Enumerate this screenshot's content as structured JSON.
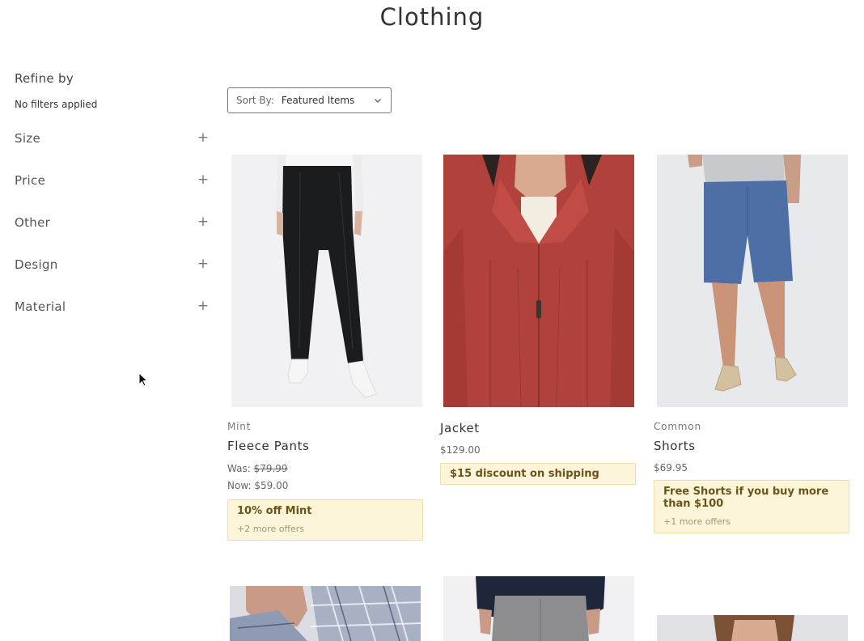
{
  "page": {
    "title": "Clothing"
  },
  "sidebar": {
    "heading": "Refine by",
    "status": "No filters applied",
    "facets": [
      {
        "label": "Size",
        "icon": "plus-icon"
      },
      {
        "label": "Price",
        "icon": "plus-icon"
      },
      {
        "label": "Other",
        "icon": "plus-icon"
      },
      {
        "label": "Design",
        "icon": "plus-icon"
      },
      {
        "label": "Material",
        "icon": "plus-icon"
      }
    ]
  },
  "sort": {
    "label": "Sort By:",
    "value": "Featured Items"
  },
  "products": [
    {
      "brand": "Mint",
      "name": "Fleece Pants",
      "was_label": "Was:",
      "was_price": "$79.99",
      "now_label": "Now:",
      "now_price": "$59.00",
      "offer_title": "10% off Mint",
      "offer_more": "+2 more offers"
    },
    {
      "name": "Jacket",
      "price": "$129.00",
      "offer_title": "$15 discount on shipping"
    },
    {
      "brand": "Common",
      "name": "Shorts",
      "price": "$69.95",
      "offer_title": "Free Shorts if you buy more than $100",
      "offer_more": "+1 more offers"
    }
  ],
  "colors": {
    "offer_bg": "#fcf5da",
    "offer_text": "#6b5419",
    "jacket": "#b1413c",
    "shorts": "#4d6fa6"
  }
}
